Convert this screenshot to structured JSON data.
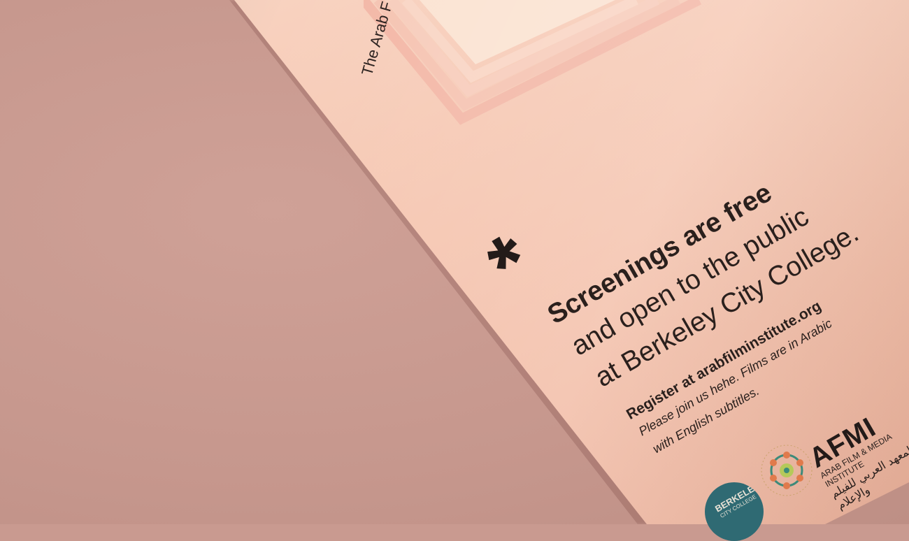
{
  "poster": {
    "vertical_text": "The Arab F",
    "headline": {
      "line1": "Screenings are free",
      "line2": "and open to the public",
      "line3": "at Berkeley City College."
    },
    "register": "Register at arabfilminstitute.org",
    "note": {
      "line1": "Please join us hehe. Films are in Arabic",
      "line2": "with English subtitles."
    }
  },
  "logos": {
    "afmi_name": "AFMI",
    "afmi_sub": "ARAB FILM & MEDIA INSTITUTE",
    "afmi_arabic": "المعهد العربي للفيلم والإعلام",
    "college_line1": "BERKELEY",
    "college_line2": "CITY COLLEGE"
  },
  "colors": {
    "surface": "#c99a90",
    "paper": "#f6c8b3",
    "ink": "#231b19",
    "badge": "#2f6a73"
  }
}
